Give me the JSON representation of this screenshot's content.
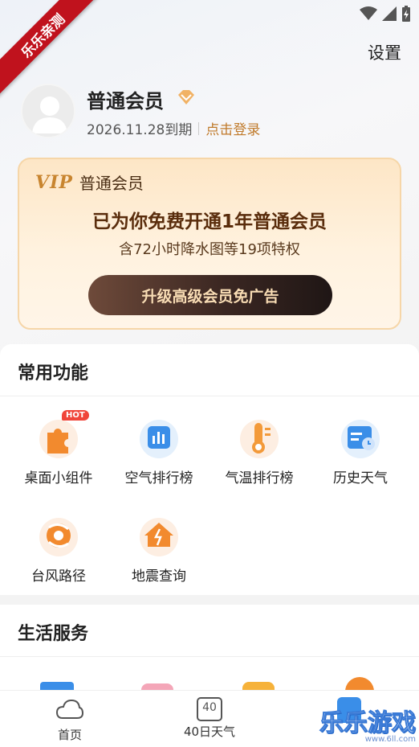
{
  "ribbon": "乐乐亲测",
  "header": {
    "settings": "设置"
  },
  "user": {
    "name": "普通会员",
    "expire": "2026.11.28到期",
    "login": "点击登录"
  },
  "vip_card": {
    "logo": "VIP",
    "type": "普通会员",
    "title": "已为你免费开通1年普通会员",
    "subtitle": "含72小时降水图等19项特权",
    "button": "升级高级会员免广告"
  },
  "common": {
    "title": "常用功能",
    "hot_badge": "HOT",
    "items": [
      {
        "label": "桌面小组件",
        "icon": "puzzle-icon"
      },
      {
        "label": "空气排行榜",
        "icon": "bar-chart-icon"
      },
      {
        "label": "气温排行榜",
        "icon": "thermometer-icon"
      },
      {
        "label": "历史天气",
        "icon": "history-calendar-icon"
      },
      {
        "label": "台风路径",
        "icon": "typhoon-icon"
      },
      {
        "label": "地震查询",
        "icon": "earthquake-house-icon"
      }
    ]
  },
  "life": {
    "title": "生活服务"
  },
  "nav": {
    "home": "首页",
    "forecast40": "40日天气",
    "forecast40_icon_text": "40"
  },
  "watermark": {
    "main": "乐乐游戏",
    "url": "www.6ll.com"
  },
  "colors": {
    "accent_gold": "#c07a2b",
    "vip_button_dark": "#1f1615",
    "ribbon_red": "#c0121d",
    "hot_red": "#f0453a"
  }
}
